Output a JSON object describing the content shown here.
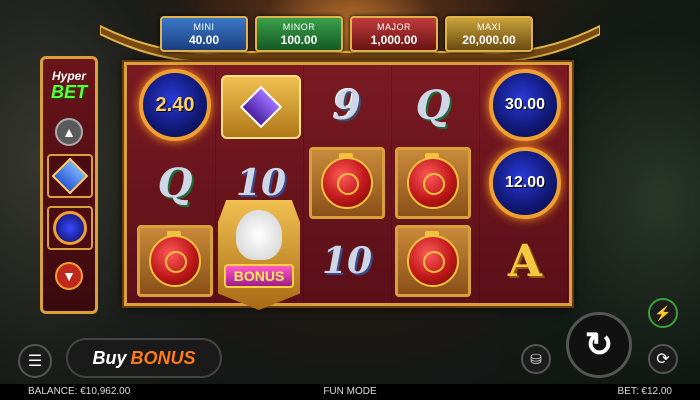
{
  "jackpots": {
    "mini": {
      "name": "MINI",
      "value": "40.00"
    },
    "minor": {
      "name": "MINOR",
      "value": "100.00"
    },
    "major": {
      "name": "MAJOR",
      "value": "1,000.00"
    },
    "maxi": {
      "name": "MAXI",
      "value": "20,000.00"
    }
  },
  "hyper_bet": {
    "line1": "Hyper",
    "line2": "BET"
  },
  "reels": {
    "orb_values": {
      "r1c1": "2.40",
      "r1c5": "30.00",
      "r2c5": "12.00"
    },
    "symbols": {
      "r1c3": "9",
      "r1c4": "Q",
      "r2c1": "Q",
      "r2c2": "10",
      "r3c3": "10",
      "r3c5": "A"
    },
    "bonus_label": "BONUS"
  },
  "controls": {
    "buy_bonus": {
      "part1": "Buy",
      "part2": "BONUS"
    }
  },
  "status": {
    "balance": "BALANCE: €10,962.00",
    "mode": "FUN MODE",
    "bet": "BET: €12.00"
  },
  "colors": {
    "frame_gold": "#d8a13a",
    "reel_bg": "#7a1a22",
    "buy_bonus_accent": "#ff7a1a",
    "hyper_bet_green": "#5aff3a"
  }
}
